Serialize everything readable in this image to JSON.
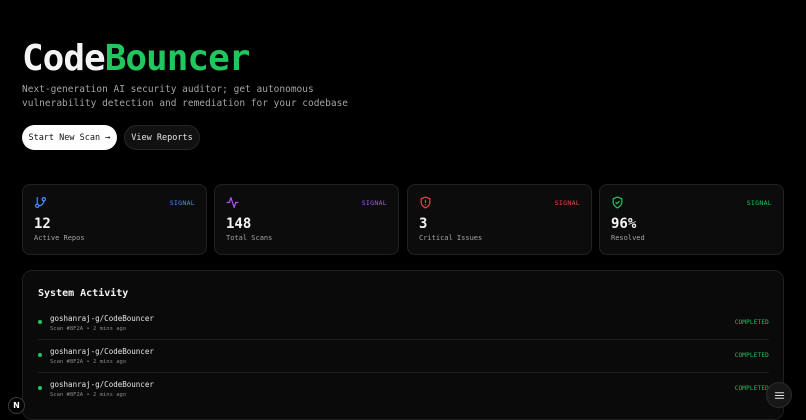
{
  "hero": {
    "title_part1": "Code",
    "title_part2": "Bouncer",
    "subtitle_line1": "Next-generation AI security auditor; get autonomous",
    "subtitle_line2": "vulnerability detection and remediation for your codebase"
  },
  "actions": {
    "primary_label": "Start New Scan",
    "primary_icon": "arrow-right-icon",
    "primary_arrow": "→",
    "secondary_label": "View Reports"
  },
  "stats": [
    {
      "icon": "git-branch-icon",
      "signal": "SIGNAL",
      "value": "12",
      "label": "Active Repos",
      "color": "#4a8cff"
    },
    {
      "icon": "activity-icon",
      "signal": "SIGNAL",
      "value": "148",
      "label": "Total Scans",
      "color": "#a855f7"
    },
    {
      "icon": "shield-alert-icon",
      "signal": "SIGNAL",
      "value": "3",
      "label": "Critical Issues",
      "color": "#ef4444"
    },
    {
      "icon": "shield-check-icon",
      "signal": "SIGNAL",
      "value": "96%",
      "label": "Resolved",
      "color": "#22c55e"
    }
  ],
  "activity": {
    "title": "System Activity",
    "items": [
      {
        "repo": "goshanraj-g/CodeBouncer",
        "meta": "Scan #8F2A • 2 mins ago",
        "status": "COMPLETED"
      },
      {
        "repo": "goshanraj-g/CodeBouncer",
        "meta": "Scan #8F2A • 2 mins ago",
        "status": "COMPLETED"
      },
      {
        "repo": "goshanraj-g/CodeBouncer",
        "meta": "Scan #8F2A • 2 mins ago",
        "status": "COMPLETED"
      }
    ]
  },
  "overlay": {
    "badge_letter": "N",
    "menu_icon": "menu-icon"
  },
  "colors": {
    "accent": "#22c55e",
    "background": "#000000"
  }
}
